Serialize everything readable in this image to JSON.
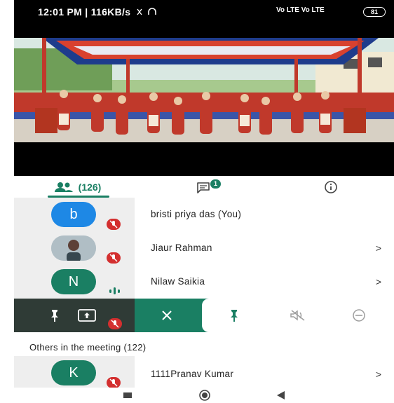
{
  "status_bar": {
    "time_text": "12:01 PM | 116KB/s",
    "signal_text": "Vo LTE  Vo LTE",
    "battery": "81"
  },
  "tabs": {
    "people_count": "(126)",
    "chat_badge": "1"
  },
  "participants": [
    {
      "initial": "b",
      "name": "bristi priya das (You)",
      "color": "#1e88e5",
      "status": "muted",
      "chevron": ""
    },
    {
      "initial": "",
      "name": "Jiaur Rahman",
      "color": "#9e9e9e",
      "status": "muted",
      "chevron": ">"
    },
    {
      "initial": "N",
      "name": "Nilaw Saikia",
      "color": "#1a7f63",
      "status": "speaking",
      "chevron": ">"
    }
  ],
  "others_heading": "Others in the meeting (122)",
  "others": [
    {
      "initial": "K",
      "name": "1111Pranav Kumar",
      "color": "#1a7f63",
      "status": "muted",
      "chevron": ">"
    }
  ],
  "colors": {
    "accent": "#1a7f63",
    "mute_red": "#d32f2f"
  }
}
